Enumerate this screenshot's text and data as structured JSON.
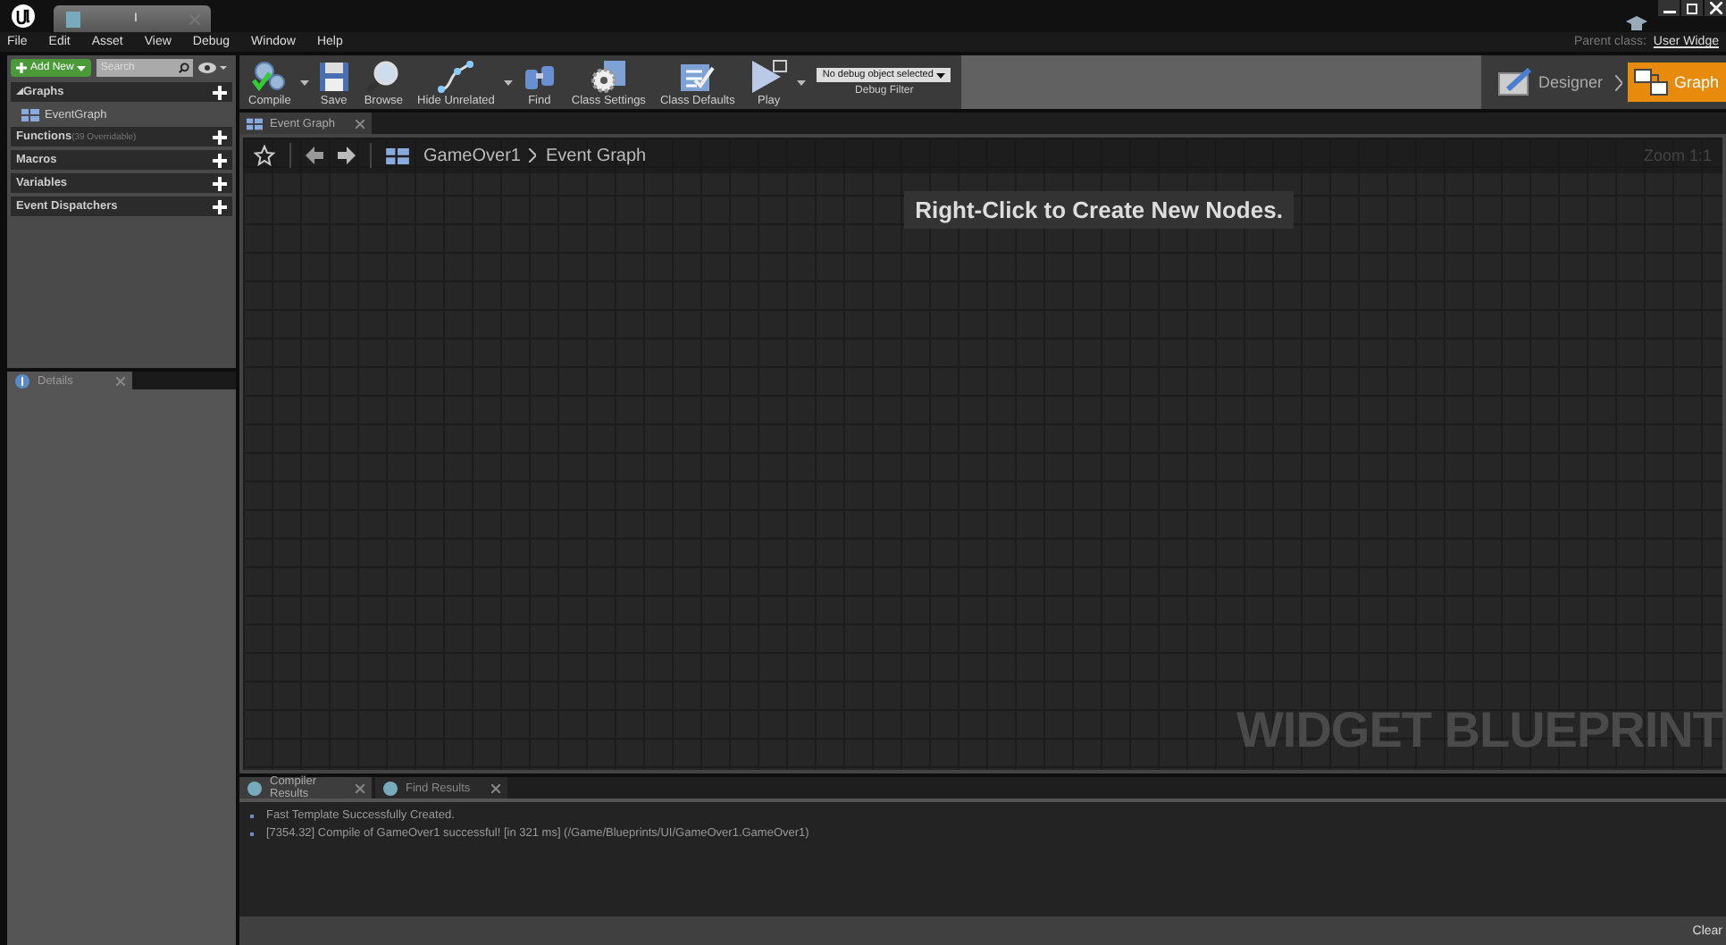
{
  "title_tab": {
    "label": "I"
  },
  "menu": [
    "File",
    "Edit",
    "Asset",
    "View",
    "Debug",
    "Window",
    "Help"
  ],
  "parent_class": {
    "label": "Parent class:",
    "value": "User Widge"
  },
  "my_blueprint": {
    "add_new": "Add New",
    "search": {
      "placeholder": "Search"
    },
    "sections": [
      {
        "label": "Graphs",
        "expanded": true,
        "children": [
          {
            "label": "EventGraph"
          }
        ]
      },
      {
        "label": "Functions",
        "note": "(39 Overridable)",
        "expanded": false
      },
      {
        "label": "Macros",
        "expanded": false
      },
      {
        "label": "Variables",
        "expanded": false
      },
      {
        "label": "Event Dispatchers",
        "expanded": false
      }
    ]
  },
  "details_tab": {
    "label": "Details"
  },
  "toolbar": [
    {
      "kind": "compile",
      "label": "Compile",
      "dropdown": true
    },
    {
      "kind": "save",
      "label": "Save",
      "dropdown": false
    },
    {
      "kind": "browse",
      "label": "Browse",
      "dropdown": false
    },
    {
      "kind": "hide",
      "label": "Hide Unrelated",
      "dropdown": true
    },
    {
      "kind": "find",
      "label": "Find",
      "dropdown": false
    },
    {
      "kind": "settings",
      "label": "Class Settings",
      "dropdown": false
    },
    {
      "kind": "defaults",
      "label": "Class Defaults",
      "dropdown": false
    },
    {
      "kind": "play",
      "label": "Play",
      "dropdown": true
    }
  ],
  "debug_filter": {
    "value": "No debug object selected",
    "label": "Debug Filter"
  },
  "modes": [
    {
      "label": "Designer",
      "selected": false
    },
    {
      "label": "Graph",
      "selected": true
    }
  ],
  "graph_tab": {
    "label": "Event Graph"
  },
  "breadcrumb": [
    "GameOver1",
    "Event Graph"
  ],
  "zoom": "Zoom 1:1",
  "hint": "Right-Click to Create New Nodes.",
  "watermark": "WIDGET BLUEPRINT",
  "bottom_tabs": [
    {
      "label": "Compiler Results",
      "selected": true
    },
    {
      "label": "Find Results",
      "selected": false
    }
  ],
  "messages": [
    "Fast Template Successfully Created.",
    "[7354.32] Compile of GameOver1 successful! [in 321 ms] (/Game/Blueprints/UI/GameOver1.GameOver1)"
  ],
  "clear": "Clear"
}
